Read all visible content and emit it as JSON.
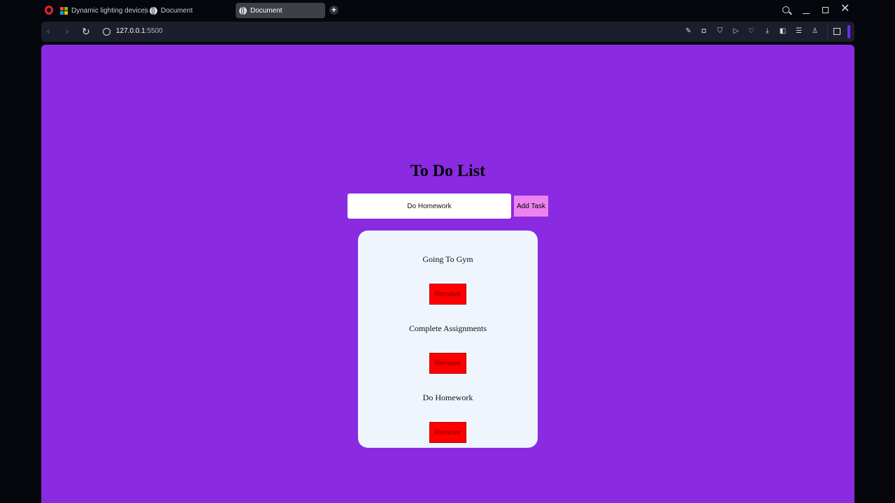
{
  "browser": {
    "tabs": [
      {
        "label": "Dynamic lighting devices",
        "icon": "microsoft-icon",
        "active": false
      },
      {
        "label": "Document",
        "icon": "globe-icon",
        "active": false
      },
      {
        "label": "Document",
        "icon": "globe-icon",
        "active": true
      }
    ],
    "url_host": "127.0.0.1",
    "url_port": ":5500"
  },
  "app": {
    "title": "To Do List",
    "input_value": "Do Homework",
    "add_button_label": "Add Task",
    "tasks": [
      {
        "text": "Going To Gym",
        "remove_label": "Remove"
      },
      {
        "text": "Complete Assignments",
        "remove_label": "Remove"
      },
      {
        "text": "Do Homework",
        "remove_label": "Remove"
      }
    ]
  },
  "colors": {
    "page_background": "#8a2be2",
    "add_button": "#ee82ee",
    "remove_button": "#ff0000",
    "list_card": "#eef5fc",
    "browser_accent": "#6c2cf0"
  }
}
